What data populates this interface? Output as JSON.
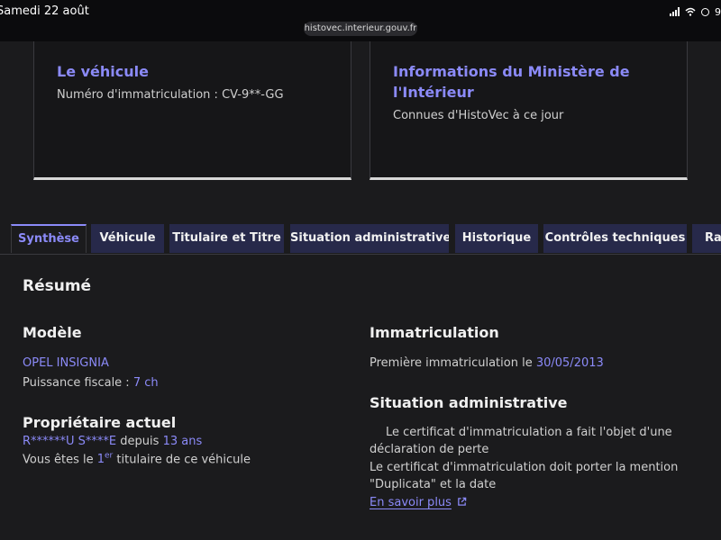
{
  "status_bar": {
    "date": "Samedi 22 août",
    "url": "histovec.interieur.gouv.fr",
    "battery": "9"
  },
  "cards": {
    "vehicle": {
      "title": "Le véhicule",
      "text": "Numéro d'immatriculation : CV-9**-GG"
    },
    "ministry": {
      "title_line1": "Informations du Ministère de",
      "title_line2": "l'Intérieur",
      "text": "Connues d'HistoVec à ce jour"
    }
  },
  "tabs": [
    {
      "label": "Synthèse",
      "active": true
    },
    {
      "label": "Véhicule",
      "active": false
    },
    {
      "label": "Titulaire et Titre",
      "active": false
    },
    {
      "label": "Situation administrative",
      "active": false
    },
    {
      "label": "Historique",
      "active": false
    },
    {
      "label": "Contrôles techniques",
      "active": false
    },
    {
      "label": "Rap",
      "active": false
    }
  ],
  "summary": {
    "heading": "Résumé",
    "model": {
      "heading": "Modèle",
      "name": "OPEL INSIGNIA",
      "power_label": "Puissance fiscale :",
      "power_value": "7 ch"
    },
    "owner": {
      "heading": "Propriétaire actuel",
      "name": "R******U S****E",
      "since_label": "depuis",
      "since_value": "13 ans",
      "rank_prefix": "Vous êtes le",
      "rank_value": "1",
      "rank_sup": "er",
      "rank_suffix": "titulaire de ce véhicule"
    },
    "registration": {
      "heading": "Immatriculation",
      "first_label": "Première immatriculation le",
      "first_date": "30/05/2013"
    },
    "admin": {
      "heading": "Situation administrative",
      "line1": "Le certificat d'immatriculation a fait l'objet d'une",
      "line2": "déclaration de perte",
      "line3": "Le certificat d'immatriculation doit porter la mention",
      "line4": "\"Duplicata\" et la date",
      "link": "En savoir plus"
    }
  },
  "colors": {
    "accent": "#8b8af8",
    "tab_bg": "#27294a",
    "background": "#1b1b1d"
  }
}
